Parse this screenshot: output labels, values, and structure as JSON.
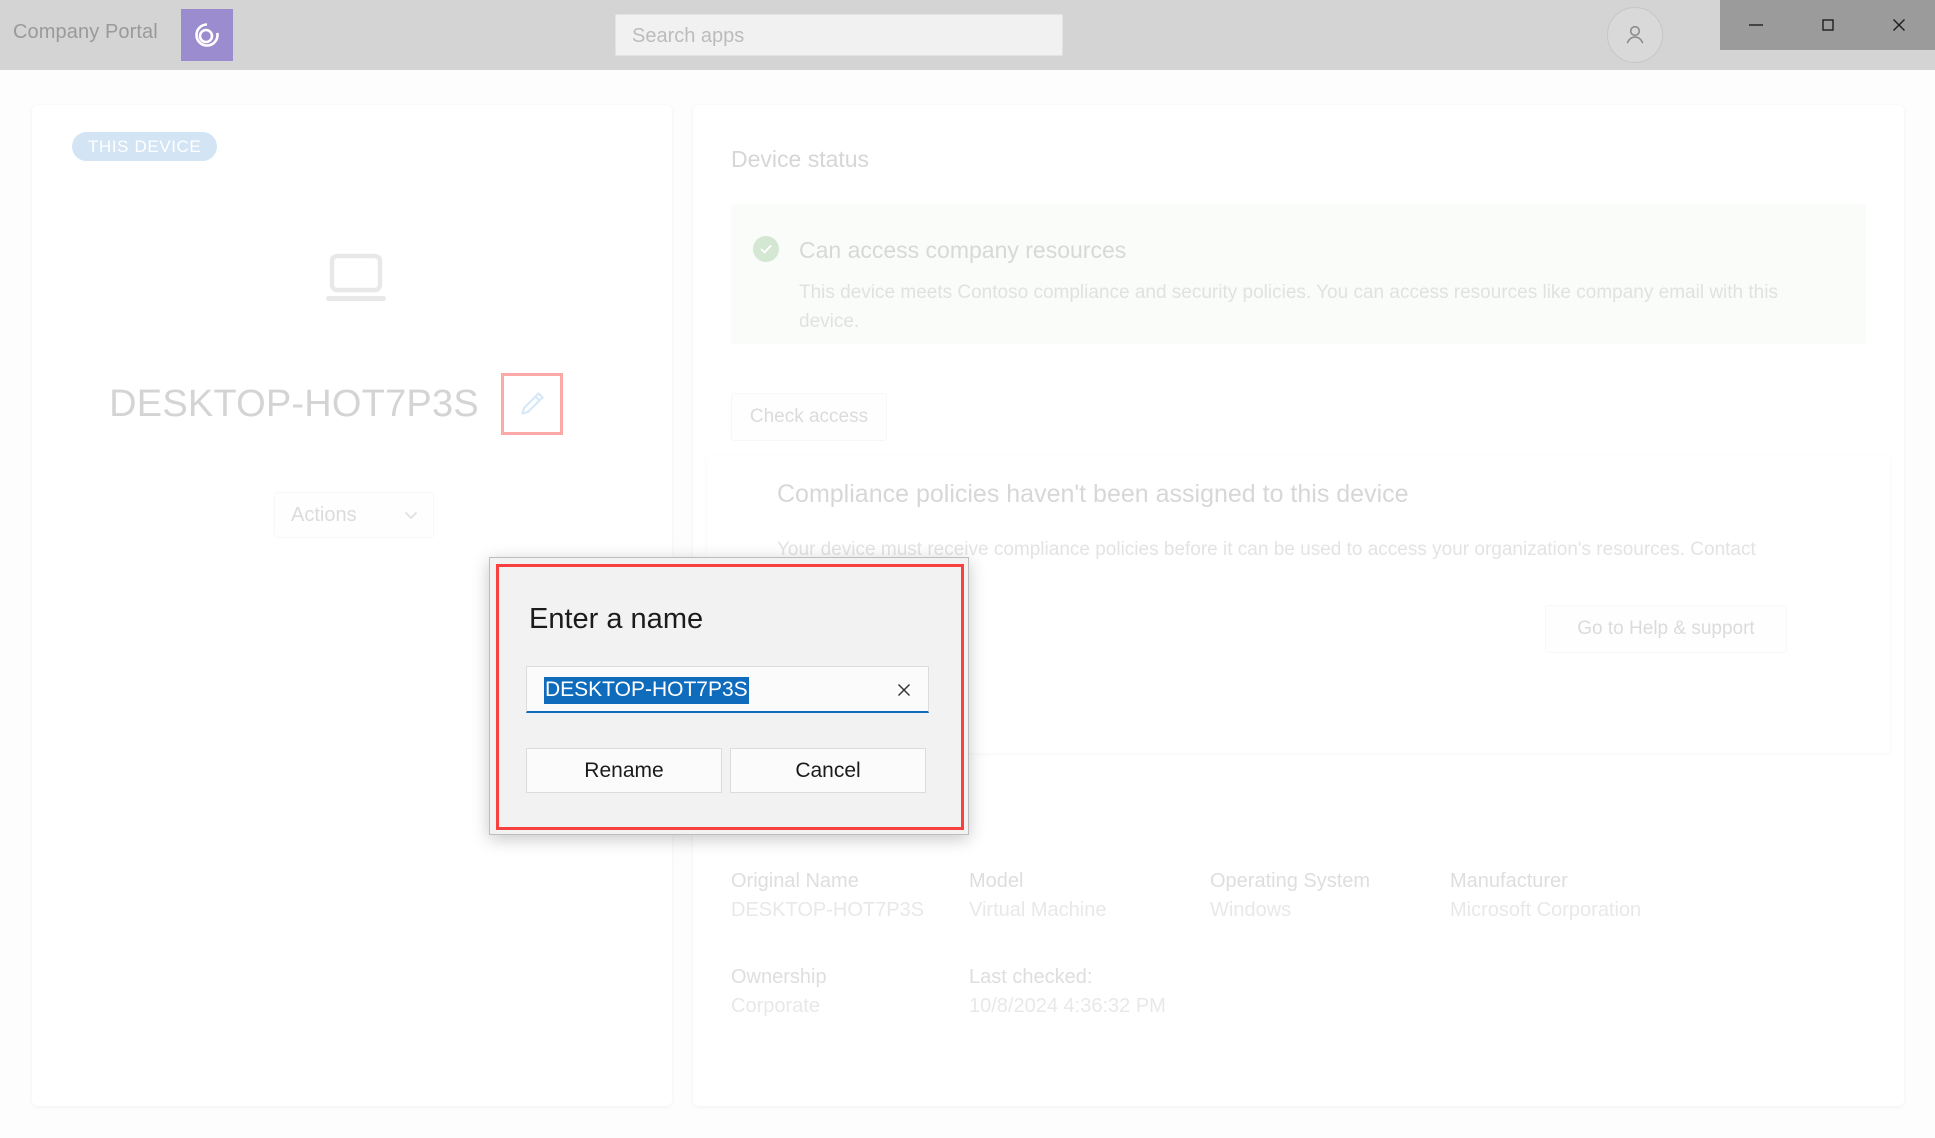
{
  "titlebar": {
    "app_title": "Company Portal",
    "logo_icon": "company-portal-spiral-logo",
    "search_placeholder": "Search apps",
    "search_value": "",
    "account_icon": "person-icon",
    "window_controls": [
      {
        "name": "minimize",
        "glyph": "—"
      },
      {
        "name": "maximize",
        "glyph": "□"
      },
      {
        "name": "close",
        "glyph": "✕"
      }
    ]
  },
  "device_card": {
    "badge": "THIS DEVICE",
    "device_icon": "laptop-icon",
    "device_name": "DESKTOP-HOT7P3S",
    "edit_icon": "pencil-icon",
    "actions_label": "Actions",
    "actions_chevron": "chevron-down-icon"
  },
  "status_card": {
    "section_title": "Device status",
    "banner": {
      "status_icon": "check-circle-icon",
      "title": "Can access company resources",
      "body": "This device meets Contoso compliance and security policies. You can access resources like company email with this device."
    },
    "check_access_label": "Check access",
    "policy": {
      "title": "Compliance policies haven't been assigned to this device",
      "body": "Your device must receive compliance policies before it can be used to access your organization's resources. Contact your support person.",
      "help_button_label": "Go to Help & support"
    },
    "details": [
      {
        "label": "Original Name",
        "value": "DESKTOP-HOT7P3S"
      },
      {
        "label": "Model",
        "value": "Virtual Machine"
      },
      {
        "label": "Operating System",
        "value": "Windows"
      },
      {
        "label": "Manufacturer",
        "value": "Microsoft Corporation"
      },
      {
        "label": "Ownership",
        "value": "Corporate"
      },
      {
        "label": "Last checked:",
        "value": "10/8/2024 4:36:32 PM"
      }
    ]
  },
  "rename_dialog": {
    "heading": "Enter a name",
    "input_value": "DESKTOP-HOT7P3S",
    "clear_icon": "close-icon",
    "rename_label": "Rename",
    "cancel_label": "Cancel"
  },
  "colors": {
    "titlebar_bg": "#d4d4d4",
    "logo_bg": "#9b8bcf",
    "badge_bg": "#9dc3e6",
    "banner_bg": "#f2f9f2",
    "status_green": "#9dca9d",
    "highlight_red": "#f8403f",
    "selection_blue": "#0f6cbd",
    "window_controls_bg": "#9b9b9b"
  }
}
